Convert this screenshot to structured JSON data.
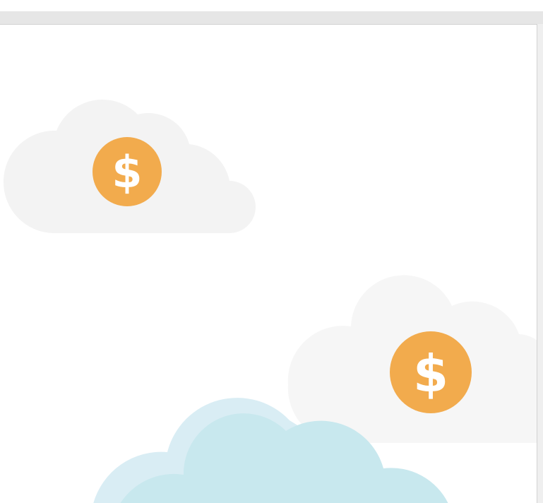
{
  "illustration": {
    "description_icons": [
      "cloud-icon",
      "dollar-coin-icon"
    ],
    "coin_symbol": "$",
    "colors": {
      "coin": "#f2ab4d",
      "coin_symbol": "#ffffff",
      "cloud_gray": "#f3f3f3",
      "cloud_gray_light": "#f6f6f6",
      "cloud_blue_light": "#d9edf4",
      "cloud_blue": "#c8e8ee",
      "background": "#ffffff",
      "chrome": "#e6e6e6"
    }
  }
}
